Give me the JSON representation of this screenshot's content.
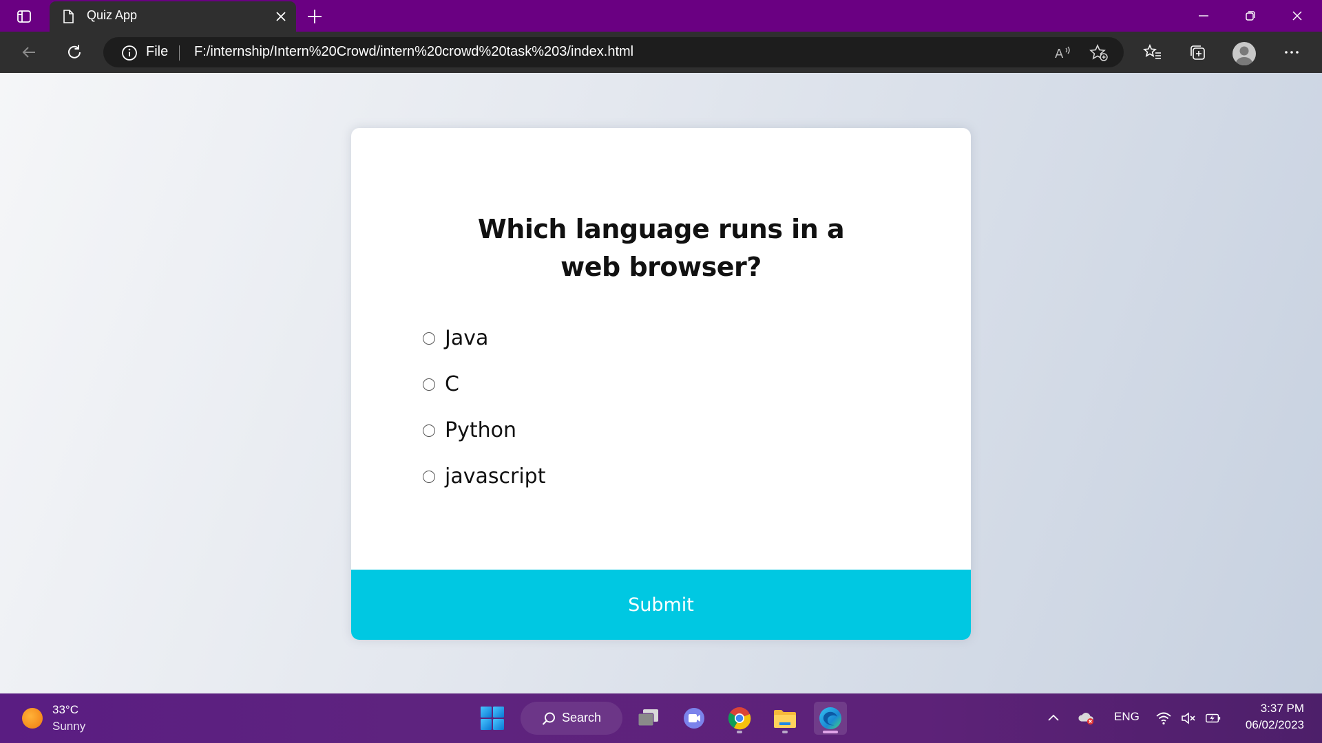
{
  "browser": {
    "tab": {
      "title": "Quiz App",
      "favicon": "page-icon"
    },
    "address": {
      "scheme_label": "File",
      "url": "F:/internship/Intern%20Crowd/intern%20crowd%20task%203/index.html"
    },
    "icons": [
      "tab-actions-icon",
      "new-tab-icon",
      "minimize-icon",
      "restore-icon",
      "close-icon",
      "back-icon",
      "refresh-icon",
      "info-icon",
      "read-aloud-icon",
      "add-favorite-icon",
      "favorites-icon",
      "collections-icon",
      "profile-icon",
      "more-icon"
    ]
  },
  "quiz": {
    "question": "Which language runs in a web browser?",
    "options": [
      {
        "label": "Java",
        "selected": false
      },
      {
        "label": "C",
        "selected": false
      },
      {
        "label": "Python",
        "selected": false
      },
      {
        "label": "javascript",
        "selected": false
      }
    ],
    "submit_label": "Submit",
    "accent_color": "#00c8e2"
  },
  "taskbar": {
    "weather": {
      "temp": "33°C",
      "desc": "Sunny"
    },
    "search_label": "Search",
    "apps": [
      "start-icon",
      "task-view-icon",
      "teams-chat-icon",
      "chrome-icon",
      "file-explorer-icon",
      "edge-icon"
    ],
    "tray": {
      "language": "ENG",
      "time": "3:37 PM",
      "date": "06/02/2023"
    }
  },
  "colors": {
    "titlebar": "#6a0082",
    "toolbar": "#2f2f2f",
    "submit": "#00c8e2"
  }
}
